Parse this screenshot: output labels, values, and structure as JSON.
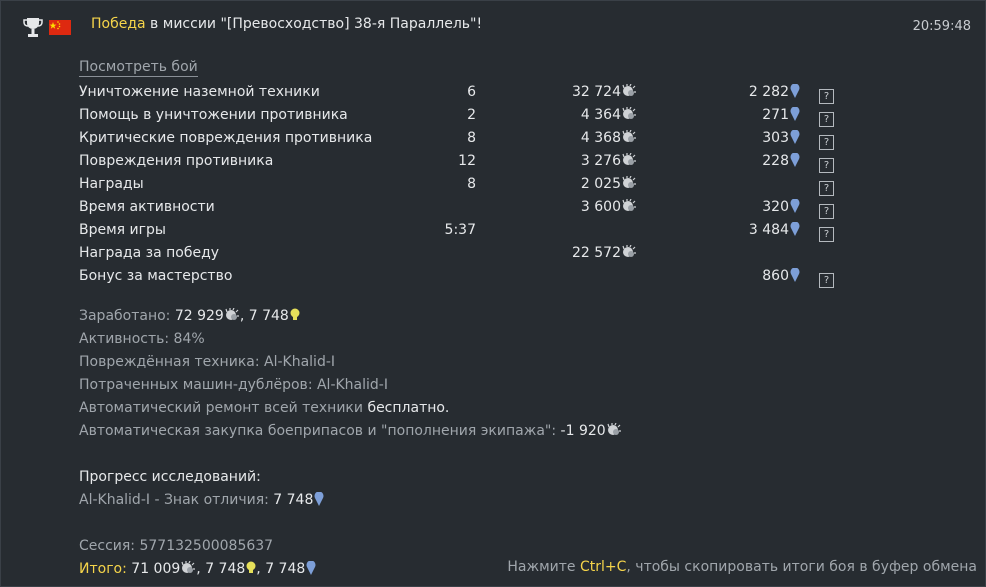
{
  "header": {
    "victory": "Победа",
    "mission_text": " в миссии \"[Превосходство] 38-я Параллель\"!",
    "time": "20:59:48"
  },
  "watch_battle": "Посмотреть бой",
  "rows": [
    {
      "name": "Уничтожение наземной техники",
      "count": "6",
      "silver": "32 724",
      "rp": "2 282",
      "help": "?"
    },
    {
      "name": "Помощь в уничтожении противника",
      "count": "2",
      "silver": "4 364",
      "rp": "271",
      "help": "?"
    },
    {
      "name": "Критические повреждения противника",
      "count": "8",
      "silver": "4 368",
      "rp": "303",
      "help": "?"
    },
    {
      "name": "Повреждения противника",
      "count": "12",
      "silver": "3 276",
      "rp": "228",
      "help": "?"
    },
    {
      "name": "Награды",
      "count": "8",
      "silver": "2 025",
      "rp": "",
      "help": "?"
    },
    {
      "name": "Время активности",
      "count": "",
      "silver": "3 600",
      "rp": "320",
      "help": "?"
    },
    {
      "name": "Время игры",
      "count": "5:37",
      "silver": "",
      "rp": "3 484",
      "help": "?"
    },
    {
      "name": "Награда за победу",
      "count": "",
      "silver": "22 572",
      "rp": "",
      "help": ""
    },
    {
      "name": "Бонус за мастерство",
      "count": "",
      "silver": "",
      "rp": "860",
      "help": "?"
    }
  ],
  "summary": {
    "earned_label": "Заработано: ",
    "earned_silver": "72 929",
    "earned_sep": ", ",
    "earned_bulb": "7 748",
    "activity_label": "Активность: ",
    "activity_value": "84%",
    "damaged_label": "Повреждённая техника: ",
    "damaged_value": "Al-Khalid-I",
    "backup_label": "Потраченных машин-дублёров: ",
    "backup_value": "Al-Khalid-I",
    "repair_label": "Автоматический ремонт всей техники ",
    "repair_value": "бесплатно.",
    "ammo_label": "Автоматическая закупка боеприпасов и \"пополнения экипажа\": ",
    "ammo_value": "-1 920"
  },
  "research": {
    "title": "Прогресс исследований:",
    "item_label": "Al-Khalid-I - Знак отличия: ",
    "item_value": "7 748"
  },
  "session": {
    "label": "Сессия: ",
    "value": "577132500085637"
  },
  "total": {
    "label": "Итого:",
    "silver": " 71 009",
    "sep1": ", ",
    "bulb": "7 748",
    "sep2": ", ",
    "rp": "7 748"
  },
  "hint": {
    "before": "Нажмите ",
    "key": "Ctrl+C",
    "after": ", чтобы скопировать итоги боя в буфер обмена"
  },
  "colors": {
    "background": "#272c31",
    "accent_yellow": "#f5d44a",
    "muted_text": "#a0a6ac",
    "rp_icon": "#7d9fd8",
    "bulb_icon": "#e6e05a",
    "silver_icon": "#cfd2d5"
  }
}
